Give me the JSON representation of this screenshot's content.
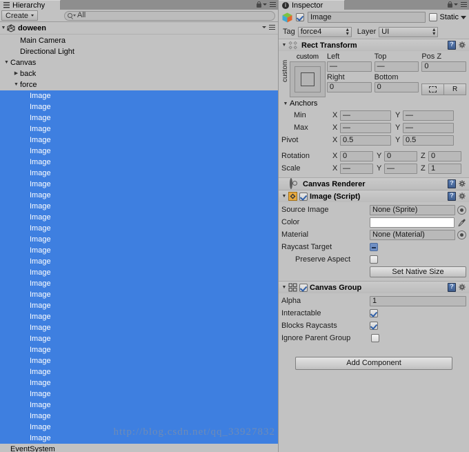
{
  "hierarchy": {
    "tab_label": "Hierarchy",
    "create_label": "Create",
    "search_value": "All",
    "search_placeholder": "All",
    "scene_name": "doween",
    "rows": [
      {
        "label": "Main Camera",
        "depth": 1,
        "arrow": "",
        "selected": false
      },
      {
        "label": "Directional Light",
        "depth": 1,
        "arrow": "",
        "selected": false
      },
      {
        "label": "Canvas",
        "depth": 0,
        "arrow": "▼",
        "selected": false
      },
      {
        "label": "back",
        "depth": 1,
        "arrow": "▶",
        "selected": false
      },
      {
        "label": "force",
        "depth": 1,
        "arrow": "▼",
        "selected": false
      },
      {
        "label": "Image",
        "depth": 2,
        "arrow": "",
        "selected": true
      },
      {
        "label": "Image",
        "depth": 2,
        "arrow": "",
        "selected": true
      },
      {
        "label": "Image",
        "depth": 2,
        "arrow": "",
        "selected": true
      },
      {
        "label": "Image",
        "depth": 2,
        "arrow": "",
        "selected": true
      },
      {
        "label": "Image",
        "depth": 2,
        "arrow": "",
        "selected": true
      },
      {
        "label": "Image",
        "depth": 2,
        "arrow": "",
        "selected": true
      },
      {
        "label": "Image",
        "depth": 2,
        "arrow": "",
        "selected": true
      },
      {
        "label": "Image",
        "depth": 2,
        "arrow": "",
        "selected": true
      },
      {
        "label": "Image",
        "depth": 2,
        "arrow": "",
        "selected": true
      },
      {
        "label": "Image",
        "depth": 2,
        "arrow": "",
        "selected": true
      },
      {
        "label": "Image",
        "depth": 2,
        "arrow": "",
        "selected": true
      },
      {
        "label": "Image",
        "depth": 2,
        "arrow": "",
        "selected": true
      },
      {
        "label": "Image",
        "depth": 2,
        "arrow": "",
        "selected": true
      },
      {
        "label": "Image",
        "depth": 2,
        "arrow": "",
        "selected": true
      },
      {
        "label": "Image",
        "depth": 2,
        "arrow": "",
        "selected": true
      },
      {
        "label": "Image",
        "depth": 2,
        "arrow": "",
        "selected": true
      },
      {
        "label": "Image",
        "depth": 2,
        "arrow": "",
        "selected": true
      },
      {
        "label": "Image",
        "depth": 2,
        "arrow": "",
        "selected": true
      },
      {
        "label": "Image",
        "depth": 2,
        "arrow": "",
        "selected": true
      },
      {
        "label": "Image",
        "depth": 2,
        "arrow": "",
        "selected": true
      },
      {
        "label": "Image",
        "depth": 2,
        "arrow": "",
        "selected": true
      },
      {
        "label": "Image",
        "depth": 2,
        "arrow": "",
        "selected": true
      },
      {
        "label": "Image",
        "depth": 2,
        "arrow": "",
        "selected": true
      },
      {
        "label": "Image",
        "depth": 2,
        "arrow": "",
        "selected": true
      },
      {
        "label": "Image",
        "depth": 2,
        "arrow": "",
        "selected": true
      },
      {
        "label": "Image",
        "depth": 2,
        "arrow": "",
        "selected": true
      },
      {
        "label": "Image",
        "depth": 2,
        "arrow": "",
        "selected": true
      },
      {
        "label": "Image",
        "depth": 2,
        "arrow": "",
        "selected": true
      },
      {
        "label": "Image",
        "depth": 2,
        "arrow": "",
        "selected": true
      },
      {
        "label": "Image",
        "depth": 2,
        "arrow": "",
        "selected": true
      },
      {
        "label": "Image",
        "depth": 2,
        "arrow": "",
        "selected": true
      },
      {
        "label": "Image",
        "depth": 2,
        "arrow": "",
        "selected": true
      },
      {
        "label": "EventSystem",
        "depth": 0,
        "arrow": "",
        "selected": false
      }
    ],
    "watermark": "http://blog.csdn.net/qq_33927832"
  },
  "inspector": {
    "tab_label": "Inspector",
    "object_name": "Image",
    "object_enabled": true,
    "static_label": "Static",
    "static_checked": false,
    "tag_label": "Tag",
    "tag_value": "force4",
    "layer_label": "Layer",
    "layer_value": "UI",
    "rect_transform": {
      "title": "Rect Transform",
      "preset_label": "custom",
      "preset_label_v": "custom",
      "left_label": "Left",
      "left_value": "—",
      "top_label": "Top",
      "top_value": "—",
      "posz_label": "Pos Z",
      "posz_value": "0",
      "right_label": "Right",
      "right_value": "0",
      "bottom_label": "Bottom",
      "bottom_value": "0",
      "raw_button": "R",
      "anchors_label": "Anchors",
      "min_label": "Min",
      "min_x": "—",
      "min_y": "—",
      "max_label": "Max",
      "max_x": "—",
      "max_y": "—",
      "pivot_label": "Pivot",
      "pivot_x": "0.5",
      "pivot_y": "0.5",
      "rotation_label": "Rotation",
      "rot_x": "0",
      "rot_y": "0",
      "rot_z": "0",
      "scale_label": "Scale",
      "scale_x": "—",
      "scale_y": "—",
      "scale_z": "1",
      "axis_x": "X",
      "axis_y": "Y",
      "axis_z": "Z"
    },
    "canvas_renderer": {
      "title": "Canvas Renderer"
    },
    "image_script": {
      "title": "Image (Script)",
      "enabled": true,
      "source_image_label": "Source Image",
      "source_image_value": "None (Sprite)",
      "color_label": "Color",
      "color_value": "#FFFFFF",
      "material_label": "Material",
      "material_value": "None (Material)",
      "raycast_label": "Raycast Target",
      "raycast_state": "mixed",
      "preserve_label": "Preserve Aspect",
      "preserve_checked": false,
      "set_native_size": "Set Native Size"
    },
    "canvas_group": {
      "title": "Canvas Group",
      "enabled": true,
      "alpha_label": "Alpha",
      "alpha_value": "1",
      "interactable_label": "Interactable",
      "interactable_checked": true,
      "blocks_label": "Blocks Raycasts",
      "blocks_checked": true,
      "ignore_label": "Ignore Parent Group",
      "ignore_checked": false
    },
    "add_component": "Add Component"
  },
  "colors": {
    "selection_blue": "#3e7fe0",
    "panel_bg": "#c2c2c2",
    "field_bg": "#b9b9b9"
  }
}
